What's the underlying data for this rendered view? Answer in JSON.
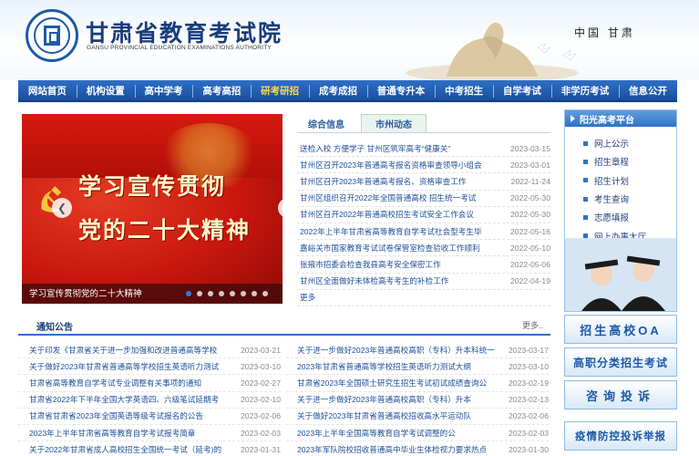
{
  "header": {
    "site_title": "甘肃省教育考试院",
    "site_subtitle": "GANSU PROVINCIAL EDUCATION EXAMINATIONS AUTHORITY",
    "region": "中国 甘肃"
  },
  "nav": {
    "items": [
      {
        "label": "网站首页"
      },
      {
        "label": "机构设置"
      },
      {
        "label": "高中学考"
      },
      {
        "label": "高考高招"
      },
      {
        "label": "研考研招"
      },
      {
        "label": "成考成招"
      },
      {
        "label": "普通专升本"
      },
      {
        "label": "中考招生"
      },
      {
        "label": "自学考试"
      },
      {
        "label": "非学历考试"
      },
      {
        "label": "信息公开"
      }
    ]
  },
  "banner": {
    "slogan_line1": "学习宣传贯彻",
    "slogan_line2": "党的二十大精神",
    "caption": "学习宣传贯彻党的二十大精神",
    "slide_count": 8,
    "active_slide": 1
  },
  "news": {
    "tab1": "综合信息",
    "tab2": "市州动态",
    "items": [
      {
        "title": "送检入校   方便学子   甘州区筑牢高考“健康关”",
        "date": "2023-03-15"
      },
      {
        "title": "甘州区召开2023年普通高考报名资格审查领导小组会",
        "date": "2023-03-01"
      },
      {
        "title": "甘州区召开2023年普通高考报名、资格审查工作",
        "date": "2022-11-24"
      },
      {
        "title": "甘州区组织召开2022年全国普通高校   招生统一考试",
        "date": "2022-05-30"
      },
      {
        "title": "甘州区召开2022年普通高校招生考试安全工作会议",
        "date": "2022-05-30"
      },
      {
        "title": "2022年上半年甘肃省高等教育自学考试社会型考生毕",
        "date": "2022-05-16"
      },
      {
        "title": "嘉峪关市国家教育考试试卷保管室检查验收工作顺利",
        "date": "2022-05-10"
      },
      {
        "title": "张掖市招委会检查我县高考安全保密工作",
        "date": "2022-05-06"
      },
      {
        "title": "甘州区全面做好未体检高考考生的补检工作",
        "date": "2022-04-19"
      },
      {
        "title": "更多",
        "date": ""
      }
    ]
  },
  "sunshine": {
    "title": "阳光高考平台",
    "items": [
      "网上公示",
      "招生章程",
      "招生计划",
      "考生查询",
      "志愿填报",
      "网上办事大厅"
    ]
  },
  "notices": {
    "title": "通知公告",
    "more": "更多..",
    "left": [
      {
        "title": "关于印发《甘肃省关于进一步加强和改进普通高等学校",
        "date": "2023-03-21"
      },
      {
        "title": "关于做好2023年甘肃省普通高等学校招生英语听力测试",
        "date": "2023-03-10"
      },
      {
        "title": "甘肃省高等教育自学考试专业调整有关事项的通知",
        "date": "2023-02-27"
      },
      {
        "title": "甘肃省2022年下半年全国大学英语四、六级笔试延期考",
        "date": "2023-02-10"
      },
      {
        "title": "甘肃省甘肃省2023年全国英语等级考试报名的公告",
        "date": "2023-02-06"
      },
      {
        "title": "2023年上半年甘肃省高等教育自学考试报考简章",
        "date": "2023-02-03"
      },
      {
        "title": "关于2022年甘肃省成人高校招生全国统一考试（延考)的",
        "date": "2023-01-31"
      }
    ],
    "right": [
      {
        "title": "关于进一步做好2023年普通高校高职（专科）升本科统一",
        "date": "2023-03-17"
      },
      {
        "title": "2023年甘肃省普通高等学校招生英语听力测试大纲",
        "date": "2023-03-10"
      },
      {
        "title": "甘肃省2023年全国硕士研究生招生考试初试成绩查询公",
        "date": "2023-02-19"
      },
      {
        "title": "关于进一步做好2023年普通高校高职（专科）升本",
        "date": "2023-02-13"
      },
      {
        "title": "关于做好2023年甘肃省普通高校招收高水平运动队",
        "date": "2023-02-06"
      },
      {
        "title": "2023年上半年全国高等教育自学考试调整的公",
        "date": "2023-02-03"
      },
      {
        "title": "2023年军队院校招收普通高中毕业生体检视力要求热点",
        "date": "2023-01-30"
      }
    ]
  },
  "side_buttons": {
    "oa": "招生高校OA",
    "gaozhi": "高职分类招生考试",
    "zixun": "咨询投诉",
    "yiqing": "疫情防控投诉举报"
  },
  "colors": {
    "nav_blue": "#1a4f9f",
    "nav_active": "#ffd84a",
    "link_blue": "#1f4f99",
    "banner_red": "#c8160e"
  }
}
